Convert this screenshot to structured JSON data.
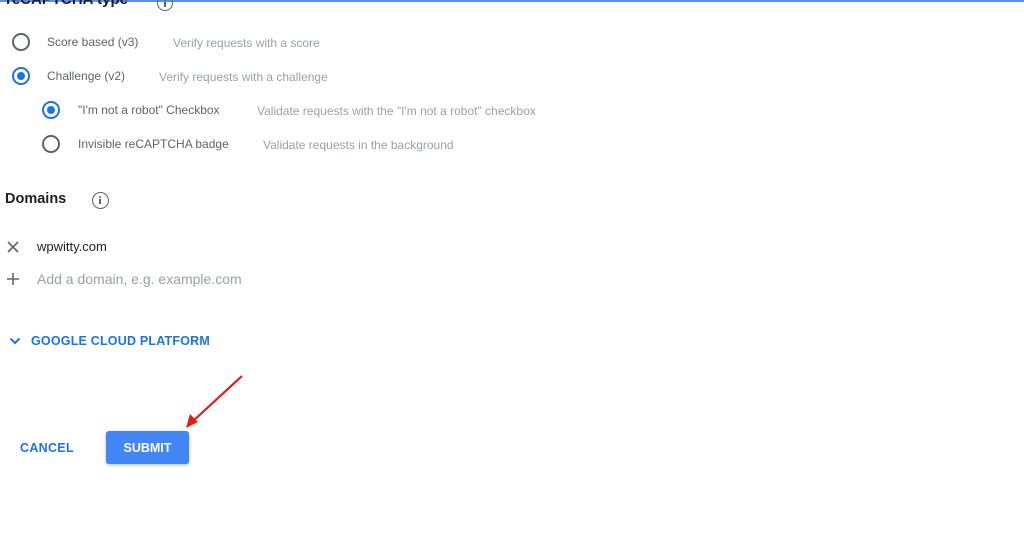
{
  "recaptcha_type": {
    "title": "reCAPTCHA type",
    "options": [
      {
        "label": "Score based (v3)",
        "description": "Verify requests with a score",
        "checked": false
      },
      {
        "label": "Challenge (v2)",
        "description": "Verify requests with a challenge",
        "checked": true
      }
    ],
    "sub_options": [
      {
        "label": "\"I'm not a robot\" Checkbox",
        "description": "Validate requests with the \"I'm not a robot\" checkbox",
        "checked": true
      },
      {
        "label": "Invisible reCAPTCHA badge",
        "description": "Validate requests in the background",
        "checked": false
      }
    ]
  },
  "domains": {
    "title": "Domains",
    "items": [
      "wpwitty.com"
    ],
    "add_placeholder": "Add a domain, e.g. example.com",
    "add_value": ""
  },
  "gcp_section": {
    "label": "GOOGLE CLOUD PLATFORM"
  },
  "actions": {
    "cancel_label": "CANCEL",
    "submit_label": "SUBMIT"
  },
  "colors": {
    "accent": "#1a73e8",
    "submit_bg": "#4285f4",
    "annotation_arrow": "#e31b1b"
  }
}
